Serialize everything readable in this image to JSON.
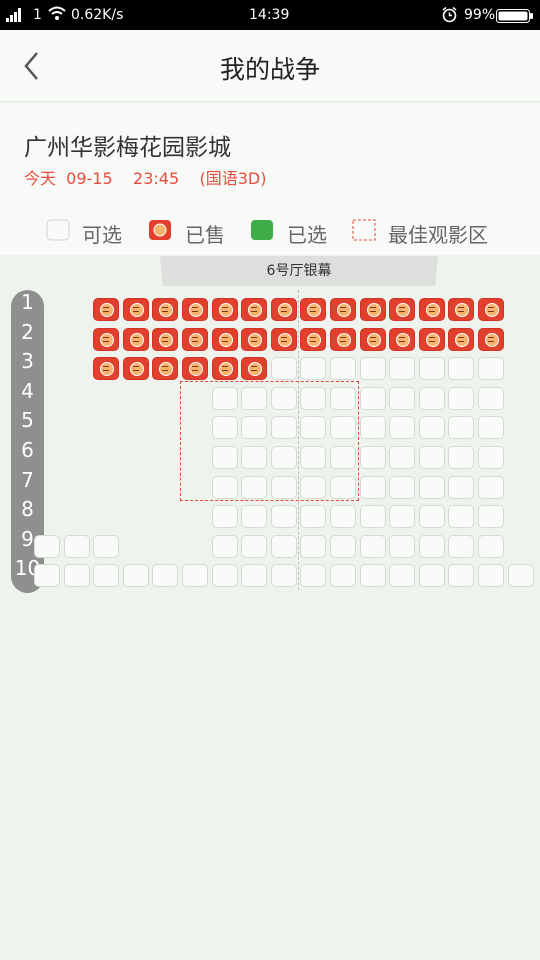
{
  "status": {
    "sim": "1",
    "speed": "0.62K/s",
    "time": "14:39",
    "battery": "99%"
  },
  "header": {
    "title": "我的战争"
  },
  "cinema": {
    "name": "广州华影梅花园影城",
    "showtime": "今天  09-15    23:45    (国语3D)"
  },
  "legend": {
    "available": "可选",
    "sold": "已售",
    "selected": "已选"
  },
  "legend_best": "最佳观影区",
  "screen": {
    "label": "6号厅银幕"
  },
  "rows": [
    "1",
    "2",
    "3",
    "4",
    "5",
    "6",
    "7",
    "8",
    "9",
    "10"
  ],
  "seat_map": [
    "  SSSSSSSSSSSSSS ",
    "  SSSSSSSSSSSSSS ",
    "  SSSSSSAAAAAAAA ",
    "      AAAAAAAAAA ",
    "      AAAAAAAAAA ",
    "      AAAAAAAAAA ",
    "      AAAAAAAAAA ",
    "      AAAAAAAAAA ",
    "AAA   AAAAAAAAAA ",
    "AAAAAAAAAAAAAAAAA"
  ],
  "colors": {
    "sold": "#e2402f",
    "selected": "#3fae49",
    "accent": "#e84c3d"
  }
}
